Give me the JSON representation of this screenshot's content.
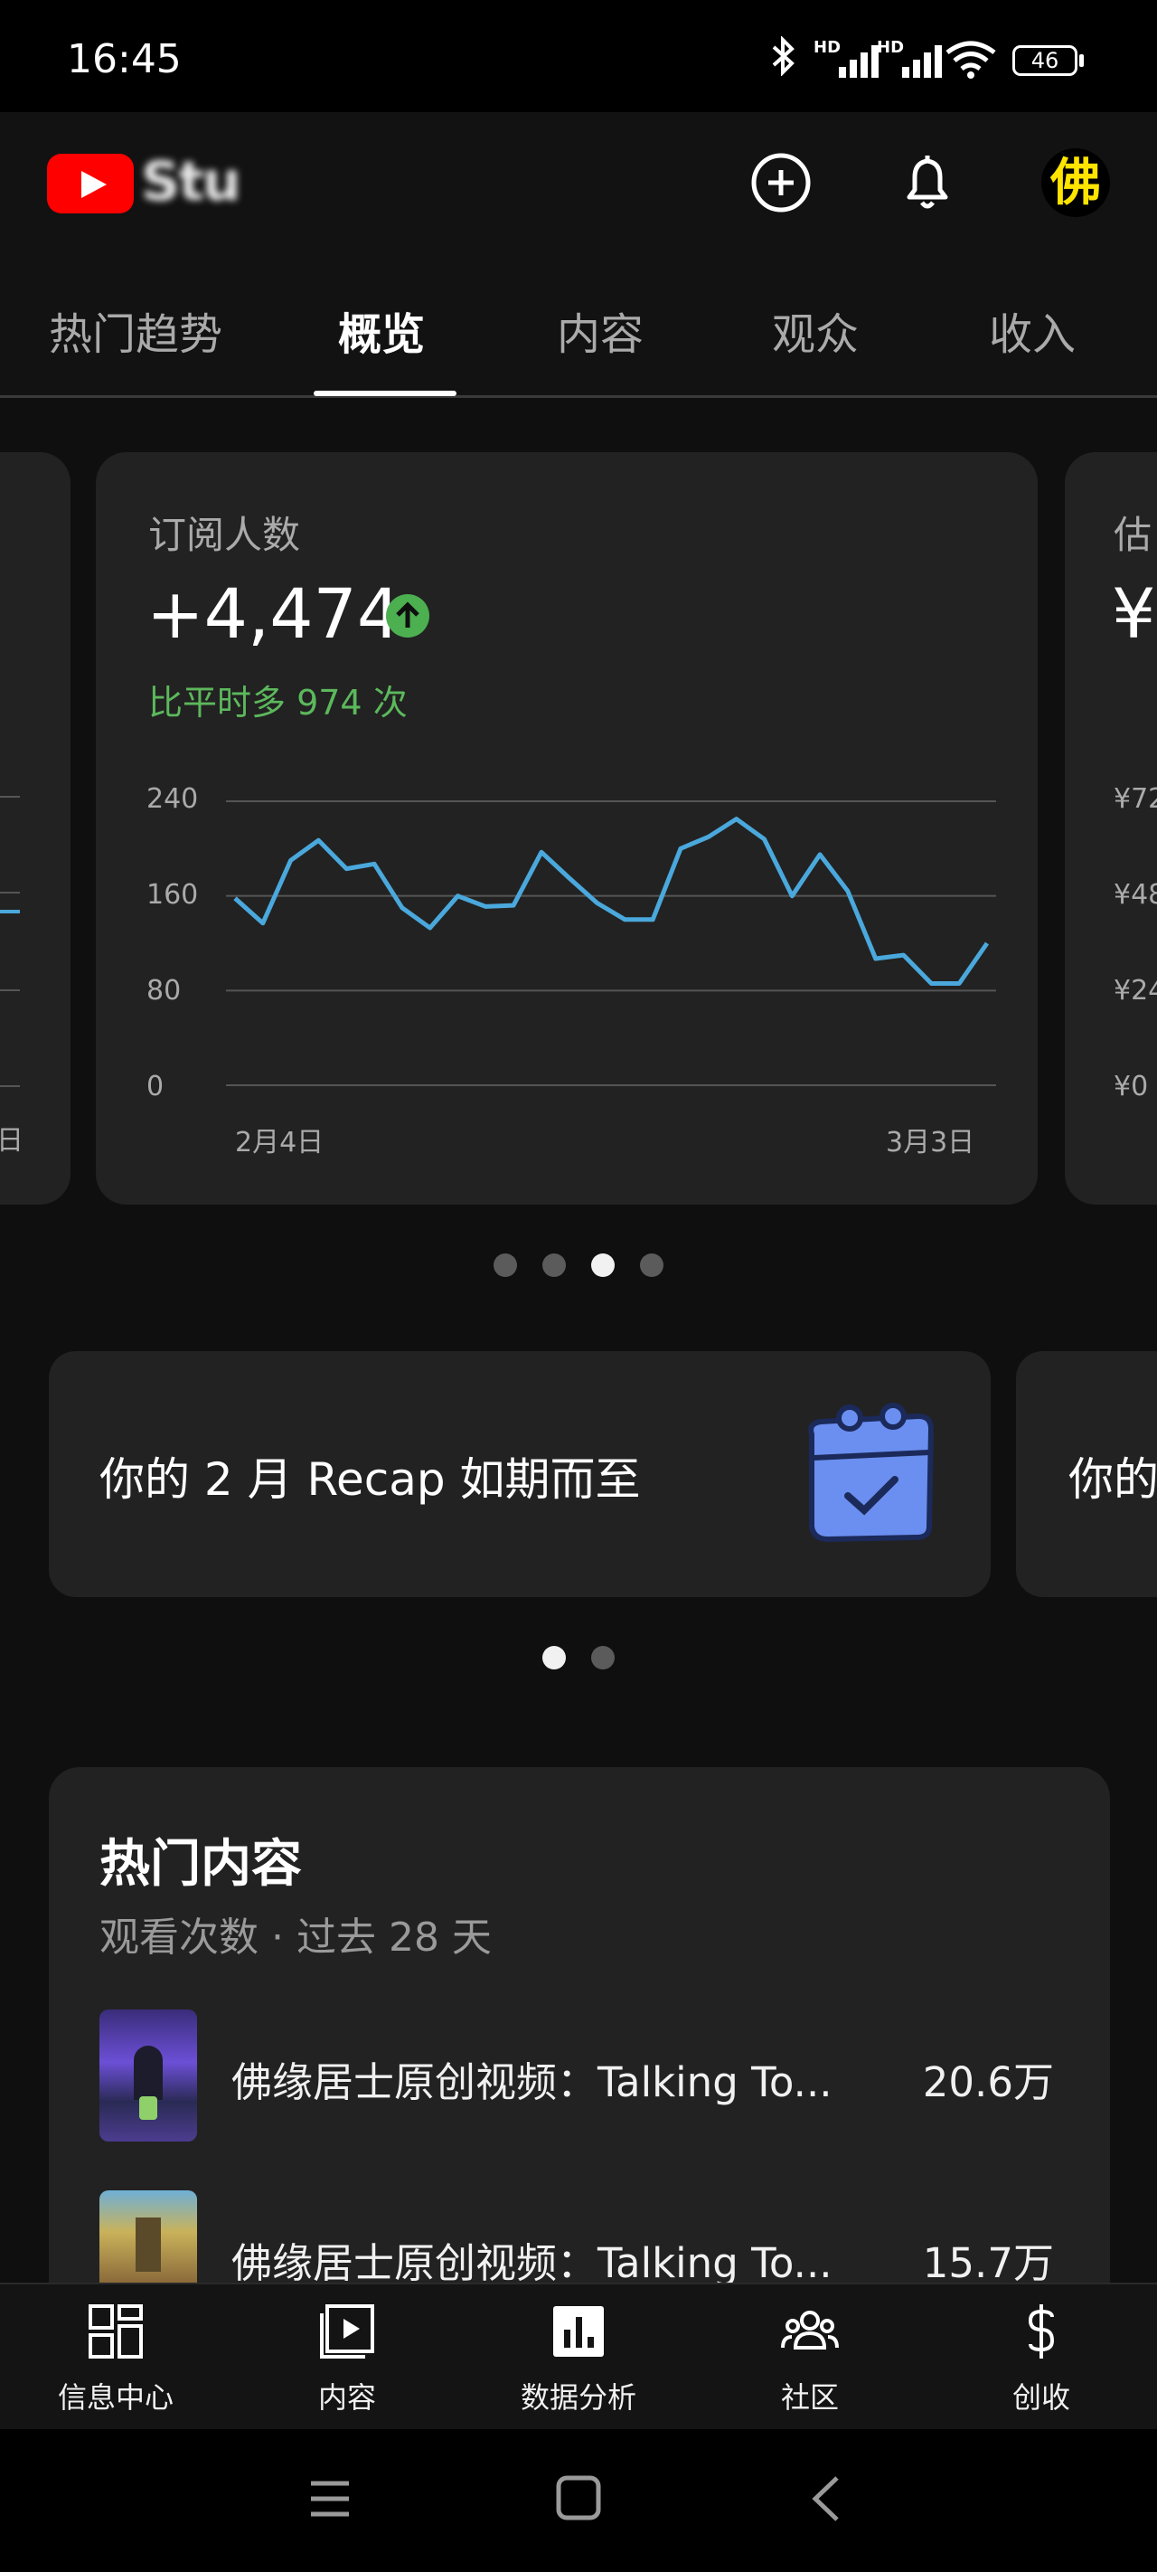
{
  "status": {
    "time": "16:45",
    "signal1": "HD",
    "signal2": "HD",
    "battery": "46",
    "icons": [
      "bluetooth-icon",
      "signal-icon",
      "signal-icon",
      "wifi-icon",
      "battery-icon"
    ]
  },
  "header": {
    "logo_text": "Stu",
    "icons": [
      "youtube-logo-icon",
      "create-plus-icon",
      "bell-icon"
    ],
    "avatar_text": "佛"
  },
  "tabs": [
    {
      "label": "热门趋势"
    },
    {
      "label": "概览"
    },
    {
      "label": "内容"
    },
    {
      "label": "观众"
    },
    {
      "label": "收入"
    }
  ],
  "subscribers_card": {
    "title": "订阅人数",
    "value": "+4,474",
    "trend_icon": "arrow-up-circle-icon",
    "compare": "比平时多 974 次",
    "y_ticks": [
      "240",
      "160",
      "80",
      "0"
    ],
    "x_start": "2月4日",
    "x_end": "3月3日"
  },
  "revenue_card_peek": {
    "title": "估",
    "value": "¥",
    "y_ticks": [
      "¥72",
      "¥48",
      "¥24",
      "¥0"
    ]
  },
  "left_card_peek": {
    "x_label": "日"
  },
  "chart_data": {
    "type": "line",
    "ylim": [
      0,
      240
    ],
    "y_ticks": [
      0,
      80,
      160,
      240
    ],
    "x_start_label": "2月4日",
    "x_end_label": "3月3日",
    "values": [
      158,
      137,
      190,
      207,
      183,
      187,
      150,
      133,
      160,
      151,
      152,
      197,
      175,
      154,
      140,
      140,
      200,
      210,
      225,
      208,
      160,
      195,
      164,
      107,
      110,
      86,
      86,
      120
    ],
    "color": "#4aa8dc"
  },
  "carousel1": {
    "count": 4,
    "active": 2
  },
  "recap": {
    "text": "你的 2 月 Recap 如期而至",
    "icon": "calendar-check-icon",
    "peek_text": "你的"
  },
  "carousel2": {
    "count": 2,
    "active": 0
  },
  "top_content": {
    "title": "热门内容",
    "subtitle": "观看次数 · 过去 28 天",
    "items": [
      {
        "title": "佛缘居士原创视频：Talking To...",
        "views": "20.6万"
      },
      {
        "title": "佛缘居士原创视频：Talking To...",
        "views": "15.7万"
      }
    ]
  },
  "bottom_nav": [
    {
      "label": "信息中心",
      "icon": "dashboard-grid-icon"
    },
    {
      "label": "内容",
      "icon": "content-video-icon"
    },
    {
      "label": "数据分析",
      "icon": "analytics-chart-icon"
    },
    {
      "label": "社区",
      "icon": "community-people-icon"
    },
    {
      "label": "创收",
      "icon": "dollar-icon"
    }
  ],
  "system_nav": [
    "menu-icon",
    "home-square-icon",
    "back-chevron-icon"
  ]
}
